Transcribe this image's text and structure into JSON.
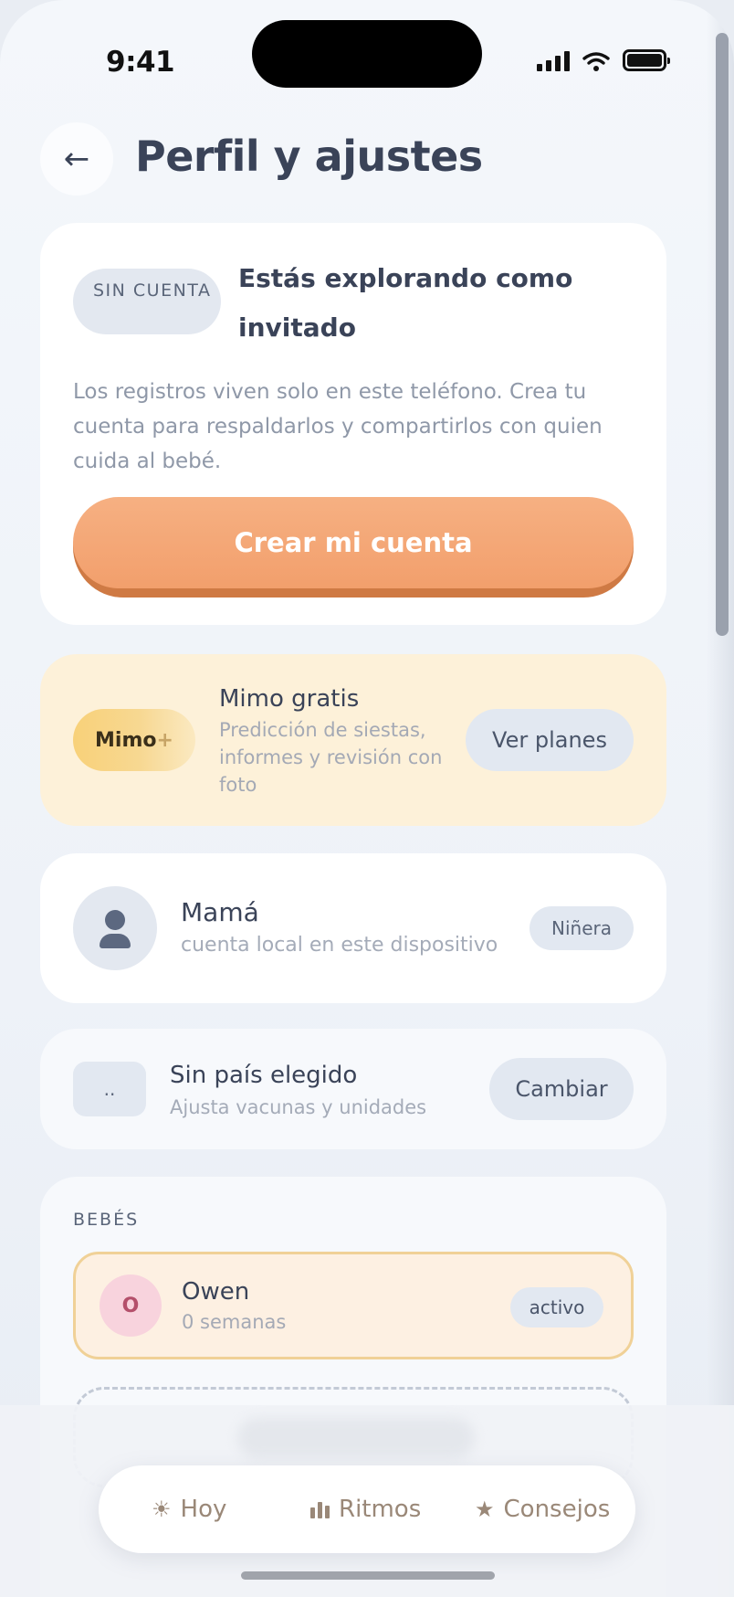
{
  "status_bar": {
    "time": "9:41"
  },
  "header": {
    "back_glyph": "←",
    "title": "Perfil y ajustes"
  },
  "guest_card": {
    "chip": "SIN CUENTA",
    "title": "Estás explorando como invitado",
    "description": "Los registros viven solo en este teléfono. Crea tu cuenta para respaldarlos y compartirlos con quien cuida al bebé.",
    "cta_label": "Crear mi cuenta"
  },
  "plan_card": {
    "badge_text": "Mimo",
    "badge_plus": "+",
    "title": "Mimo gratis",
    "description": "Predicción de siestas, informes y revisión con foto",
    "button_label": "Ver planes"
  },
  "profile_card": {
    "name": "Mamá",
    "subtitle": "cuenta local en este dispositivo",
    "role_badge": "Niñera"
  },
  "country_card": {
    "flag_placeholder": "..",
    "title": "Sin país elegido",
    "subtitle": "Ajusta vacunas y unidades",
    "button_label": "Cambiar"
  },
  "babies_card": {
    "section_label": "BEBÉS",
    "babies": [
      {
        "initial": "O",
        "name": "Owen",
        "age": "0 semanas",
        "status": "activo"
      }
    ]
  },
  "tab_bar": {
    "tabs": [
      {
        "icon": "sun-icon",
        "label": "Hoy"
      },
      {
        "icon": "bar-chart-icon",
        "label": "Ritmos"
      },
      {
        "icon": "star-icon",
        "label": "Consejos"
      }
    ]
  },
  "colors": {
    "accent": "#f2a06d",
    "text_primary": "#3a4358",
    "text_muted": "#8f98a8",
    "plan_card_bg": "#fdf1d9",
    "tab_text": "#9a8878"
  }
}
